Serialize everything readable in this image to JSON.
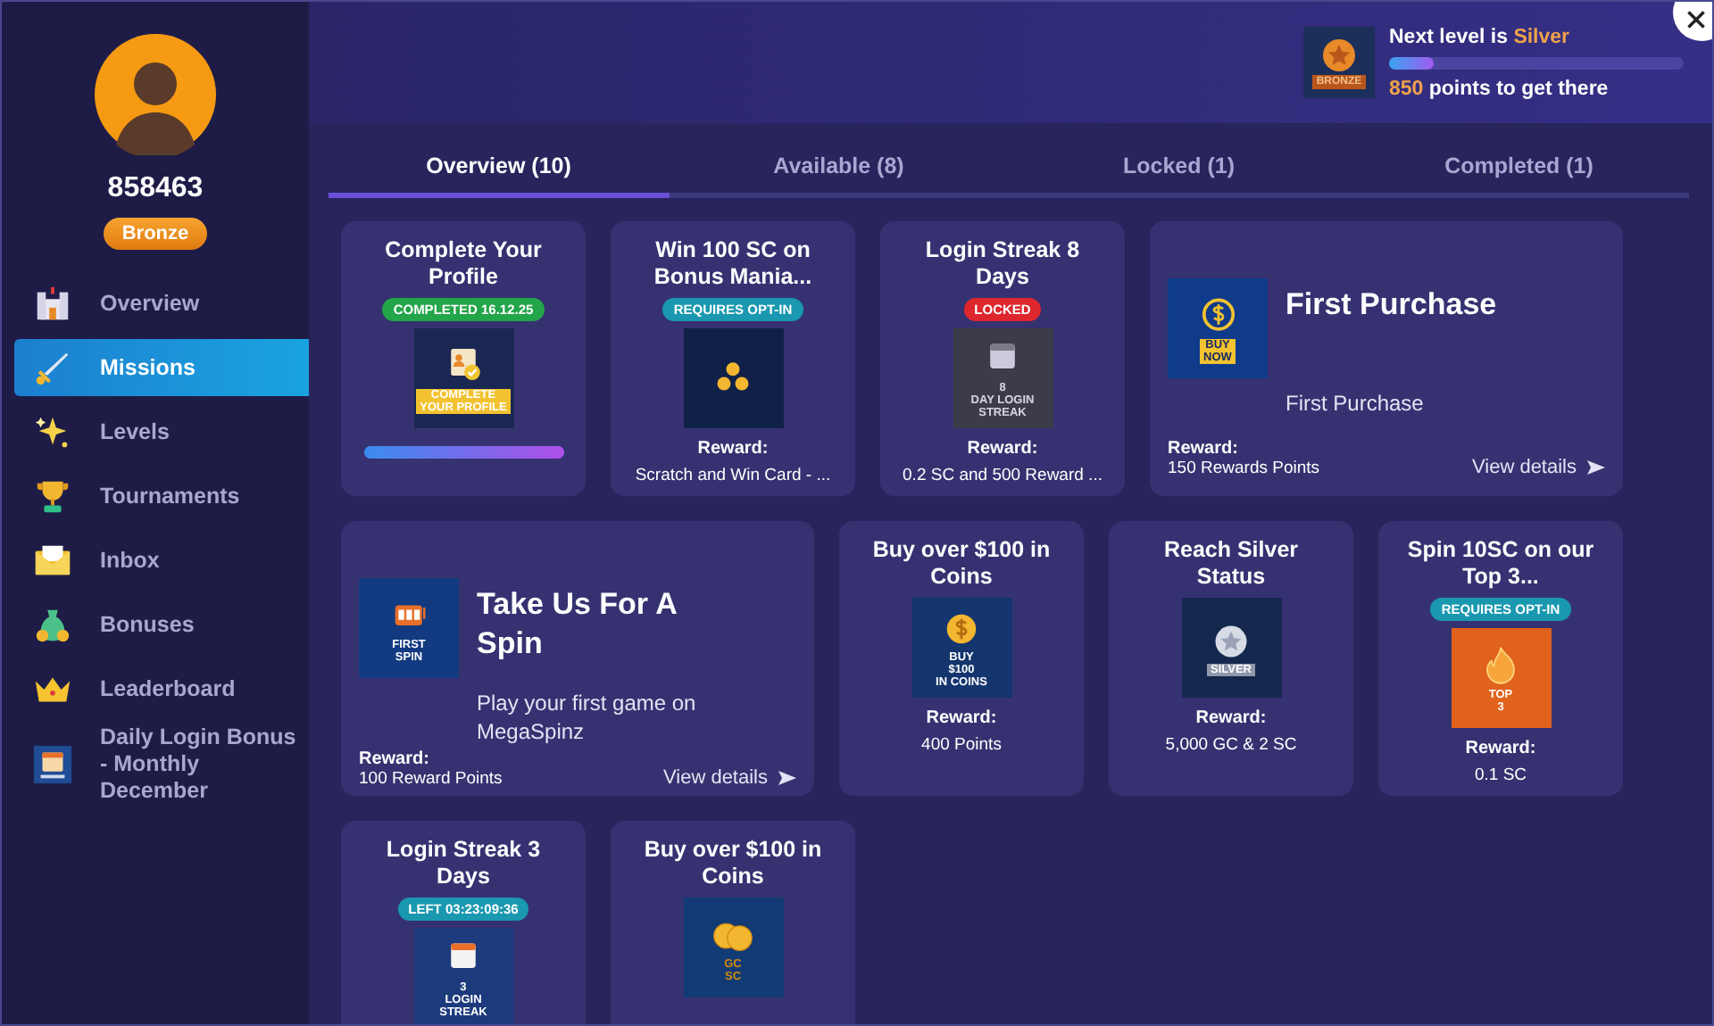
{
  "profile": {
    "username": "858463",
    "tier": "Bronze"
  },
  "sidebar": {
    "items": [
      {
        "label": "Overview",
        "selected": false
      },
      {
        "label": "Missions",
        "selected": true
      },
      {
        "label": "Levels",
        "selected": false
      },
      {
        "label": "Tournaments",
        "selected": false
      },
      {
        "label": "Inbox",
        "selected": false
      },
      {
        "label": "Bonuses",
        "selected": false
      },
      {
        "label": "Leaderboard",
        "selected": false
      },
      {
        "label": "Daily Login Bonus - Monthly December",
        "selected": false
      }
    ]
  },
  "level_progress": {
    "badge_text": "BRONZE",
    "prefix": "Next level is",
    "next_level": "Silver",
    "points": "850",
    "suffix": "points to get there",
    "level": 0.15
  },
  "tabs": [
    {
      "label": "Overview (10)",
      "selected": true
    },
    {
      "label": "Available (8)",
      "selected": false
    },
    {
      "label": "Locked (1)",
      "selected": false
    },
    {
      "label": "Completed (1)",
      "selected": false
    }
  ],
  "missions": [
    {
      "kind": "compact",
      "title": "Complete Your Profile",
      "badge": {
        "text": "COMPLETED 16.12.25",
        "kind": "completed"
      },
      "image": {
        "kind": "profile",
        "text": [
          "COMPLETE",
          "YOUR PROFILE"
        ]
      },
      "progress": {
        "level": 1
      }
    },
    {
      "kind": "compact",
      "title": "Win 100 SC on Bonus Mania...",
      "badge": {
        "text": "REQUIRES OPT-IN",
        "kind": "optin"
      },
      "image": {
        "kind": "medals"
      },
      "reward_label": "Reward:",
      "reward": "Scratch and Win Card - ..."
    },
    {
      "kind": "compact",
      "title": "Login Streak 8 Days",
      "badge": {
        "text": "LOCKED",
        "kind": "locked"
      },
      "image": {
        "kind": "calendar",
        "text": [
          "8",
          "DAY LOGIN",
          "STREAK"
        ]
      },
      "reward_label": "Reward:",
      "reward": "0.2 SC and 500 Reward ..."
    },
    {
      "kind": "wide",
      "title": "First Purchase",
      "description": "First Purchase",
      "image": {
        "kind": "buy",
        "text": [
          "BUY",
          "NOW"
        ]
      },
      "reward_label": "Reward:",
      "reward": "150 Rewards Points",
      "link": "View details"
    },
    {
      "kind": "wide",
      "title": "Take Us For A Spin",
      "description": "Play your first game on MegaSpinz",
      "image": {
        "kind": "slot",
        "text": [
          "FIRST",
          "SPIN"
        ]
      },
      "reward_label": "Reward:",
      "reward": "100 Reward Points",
      "link": "View details"
    },
    {
      "kind": "compact",
      "title": "Buy over $100 in Coins",
      "image": {
        "kind": "coin",
        "text": [
          "BUY",
          "$100",
          "IN COINS"
        ]
      },
      "reward_label": "Reward:",
      "reward": "400 Points"
    },
    {
      "kind": "compact",
      "title": "Reach Silver Status",
      "image": {
        "kind": "silver",
        "text": [
          "SILVER"
        ]
      },
      "reward_label": "Reward:",
      "reward": "5,000 GC & 2 SC"
    },
    {
      "kind": "compact",
      "title": "Spin 10SC on our Top 3...",
      "badge": {
        "text": "REQUIRES OPT-IN",
        "kind": "optin"
      },
      "image": {
        "kind": "top3",
        "text": [
          "TOP",
          "3"
        ]
      },
      "reward_label": "Reward:",
      "reward": "0.1 SC"
    },
    {
      "kind": "compact",
      "title": "Login Streak 3 Days",
      "badge": {
        "text": "LEFT 03:23:09:36",
        "kind": "timer"
      },
      "image": {
        "kind": "calendar",
        "text": [
          "3",
          "LOGIN",
          "STREAK"
        ]
      }
    },
    {
      "kind": "compact",
      "title": "Buy over $100 in Coins",
      "image": {
        "kind": "coins",
        "text": [
          "GC",
          "SC"
        ]
      }
    }
  ]
}
